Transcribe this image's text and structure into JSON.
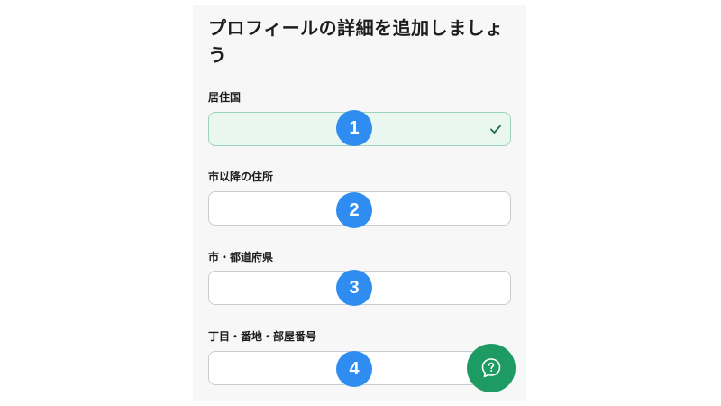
{
  "form": {
    "title": "プロフィールの詳細を追加しましょう",
    "fields": [
      {
        "label": "居住国",
        "value": "",
        "state": "selected-valid"
      },
      {
        "label": "市以降の住所",
        "value": ""
      },
      {
        "label": "市・都道府県",
        "value": ""
      },
      {
        "label": "丁目・番地・部屋番号",
        "value": ""
      }
    ]
  },
  "annotations": [
    "1",
    "2",
    "3",
    "4"
  ],
  "icons": {
    "country_check": "check-icon",
    "help": "help-question-icon"
  },
  "colors": {
    "accent_green": "#1e9b63",
    "selected_field_bg": "#eaf6f0",
    "marker_blue": "#2f8cf0"
  }
}
